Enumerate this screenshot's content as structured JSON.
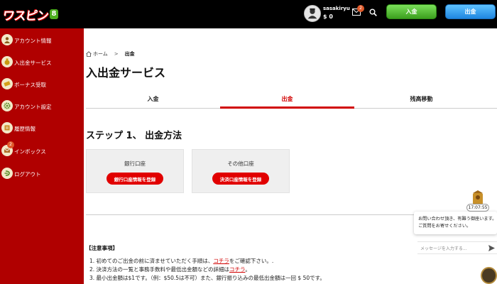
{
  "header": {
    "logo_text": "ワスピン",
    "logo_suffix": "8",
    "username": "sasakiryu",
    "balance": "$ 0",
    "mail_count": "2",
    "deposit_label": "入金",
    "withdraw_label": "出金"
  },
  "sidebar": {
    "items": [
      {
        "label": "アカウント情報",
        "icon": "user-icon"
      },
      {
        "label": "入出金サービス",
        "icon": "money-bag-icon"
      },
      {
        "label": "ボーナス受取",
        "icon": "ticket-icon"
      },
      {
        "label": "アカウント設定",
        "icon": "gear-icon"
      },
      {
        "label": "履歴情報",
        "icon": "history-icon"
      },
      {
        "label": "インボックス",
        "icon": "inbox-icon",
        "badge": "2"
      },
      {
        "label": "ログアウト",
        "icon": "logout-icon"
      }
    ]
  },
  "breadcrumb": {
    "home": "ホーム",
    "separator": ">",
    "current": "出金"
  },
  "page_title": "入出金サービス",
  "tabs": [
    {
      "label": "入金",
      "active": false
    },
    {
      "label": "出金",
      "active": true
    },
    {
      "label": "残高移動",
      "active": false
    }
  ],
  "step_title": "ステップ 1、 出金方法",
  "cards": [
    {
      "label": "銀行口座",
      "button": "銀行口座情報を登録"
    },
    {
      "label": "その他口座",
      "button": "決済口座情報を登録"
    }
  ],
  "notes": {
    "title": "【注意事項】",
    "items": [
      {
        "text": "1. 初めてのご出金の前に済ませていただく手順は、",
        "link": "コチラ",
        "after": "をご確認下さい。."
      },
      {
        "text": "2. 決済方法の一覧と事務手数料や最低出金額などの詳細は",
        "link": "コチラ",
        "after": "。"
      },
      {
        "text": "3. 最小出金額は$1です。（例：$50.5は不可）また、銀行振り込みの最低出金額は一回 $ 50です。",
        "link": "",
        "after": ""
      }
    ]
  },
  "chat": {
    "time": "17:07:55",
    "message_line1": "お問い合わせ頂き、有難う御座います。",
    "message_line2": "ご質問をお寄せください。",
    "input_placeholder": "メッセージを入力する..."
  },
  "colors": {
    "sidebar_bg": "#b00000",
    "accent_red": "#d10000",
    "deposit_green": "#4caf1e",
    "withdraw_blue": "#1f86e0"
  }
}
